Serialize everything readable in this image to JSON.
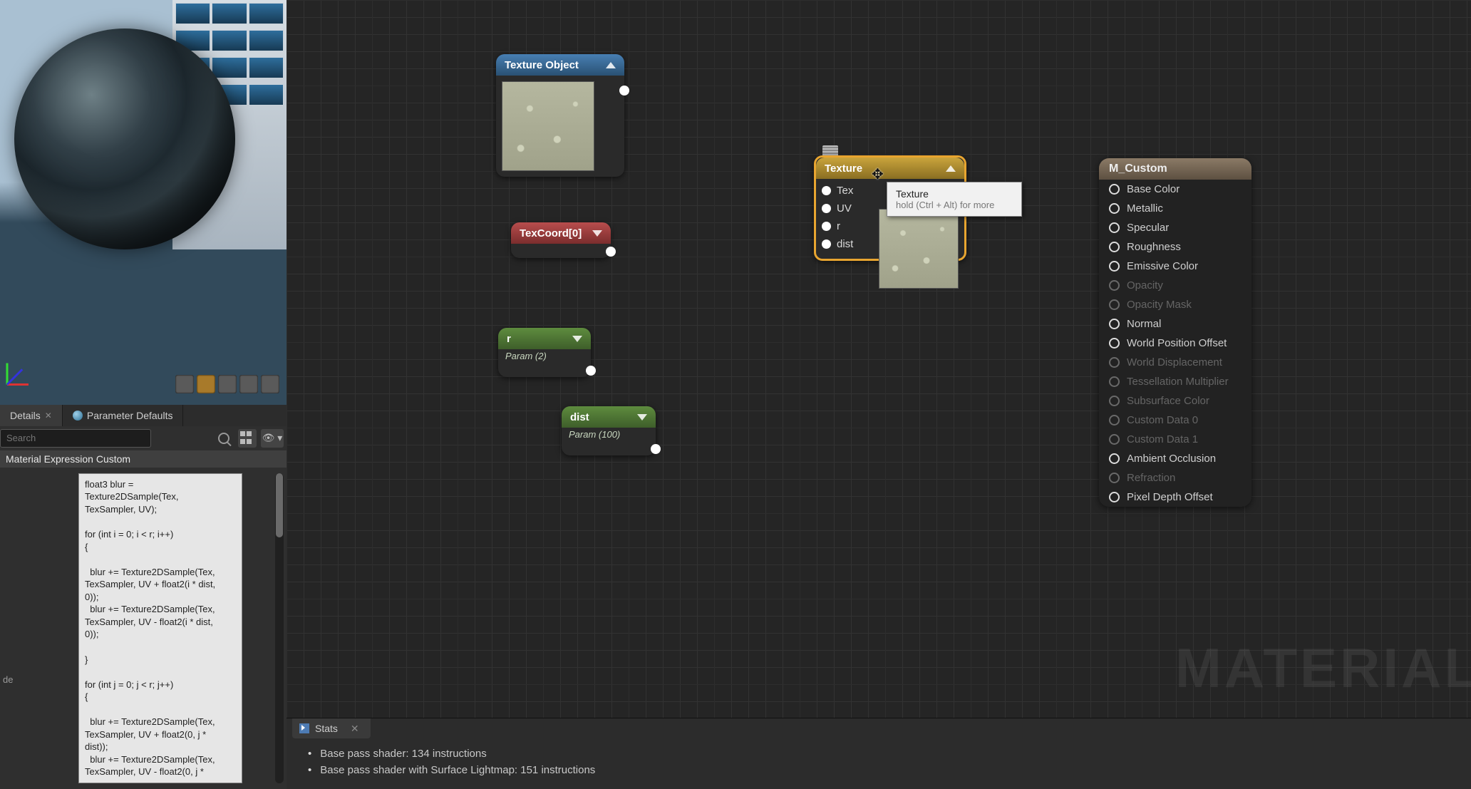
{
  "left": {
    "tabs": {
      "details": "Details",
      "param_defaults": "Parameter Defaults"
    },
    "search_placeholder": "Search",
    "section_header": "Material Expression Custom",
    "code": "float3 blur =\nTexture2DSample(Tex,\nTexSampler, UV);\n\nfor (int i = 0; i < r; i++)\n{\n\n  blur += Texture2DSample(Tex,\nTexSampler, UV + float2(i * dist,\n0));\n  blur += Texture2DSample(Tex,\nTexSampler, UV - float2(i * dist,\n0));\n\n}\n\nfor (int j = 0; j < r; j++)\n{\n\n  blur += Texture2DSample(Tex,\nTexSampler, UV + float2(0, j *\ndist));\n  blur += Texture2DSample(Tex,\nTexSampler, UV - float2(0, j *"
  },
  "nodes": {
    "tex_obj": {
      "title": "Texture Object"
    },
    "texcoord": {
      "title": "TexCoord[0]"
    },
    "r": {
      "title": "r",
      "param": "Param (2)"
    },
    "dist": {
      "title": "dist",
      "param": "Param (100)"
    },
    "texture": {
      "title": "Texture",
      "inputs": [
        "Tex",
        "UV",
        "r",
        "dist"
      ]
    }
  },
  "tooltip": {
    "title": "Texture",
    "sub": "hold (Ctrl + Alt) for more"
  },
  "result": {
    "title": "M_Custom",
    "pins": [
      {
        "label": "Base Color",
        "on": true
      },
      {
        "label": "Metallic",
        "on": true
      },
      {
        "label": "Specular",
        "on": true
      },
      {
        "label": "Roughness",
        "on": true
      },
      {
        "label": "Emissive Color",
        "on": true
      },
      {
        "label": "Opacity",
        "on": false
      },
      {
        "label": "Opacity Mask",
        "on": false
      },
      {
        "label": "Normal",
        "on": true
      },
      {
        "label": "World Position Offset",
        "on": true
      },
      {
        "label": "World Displacement",
        "on": false
      },
      {
        "label": "Tessellation Multiplier",
        "on": false
      },
      {
        "label": "Subsurface Color",
        "on": false
      },
      {
        "label": "Custom Data 0",
        "on": false
      },
      {
        "label": "Custom Data 1",
        "on": false
      },
      {
        "label": "Ambient Occlusion",
        "on": true
      },
      {
        "label": "Refraction",
        "on": false
      },
      {
        "label": "Pixel Depth Offset",
        "on": true
      }
    ]
  },
  "stats": {
    "tab": "Stats",
    "lines": [
      "Base pass shader: 134 instructions",
      "Base pass shader with Surface Lightmap: 151 instructions"
    ]
  },
  "watermark": "MATERIAL"
}
